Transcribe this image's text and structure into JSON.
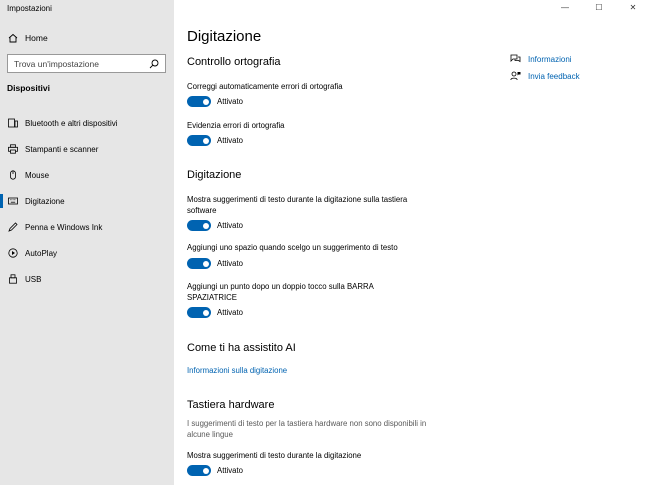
{
  "window": {
    "title": "Impostazioni",
    "minimize": "—",
    "maximize": "☐",
    "close": "✕"
  },
  "sidebar": {
    "home_label": "Home",
    "search_placeholder": "Trova un'impostazione",
    "section": "Dispositivi",
    "items": [
      {
        "label": "Bluetooth e altri dispositivi",
        "icon": "bluetooth-devices-icon"
      },
      {
        "label": "Stampanti e scanner",
        "icon": "printer-icon"
      },
      {
        "label": "Mouse",
        "icon": "mouse-icon"
      },
      {
        "label": "Digitazione",
        "icon": "keyboard-icon",
        "active": true
      },
      {
        "label": "Penna e Windows Ink",
        "icon": "pen-icon"
      },
      {
        "label": "AutoPlay",
        "icon": "autoplay-icon"
      },
      {
        "label": "USB",
        "icon": "usb-icon"
      }
    ]
  },
  "main": {
    "title": "Digitazione",
    "spell": {
      "heading": "Controllo ortografia",
      "autocorrect_label": "Correggi automaticamente errori di ortografia",
      "autocorrect_state": "Attivato",
      "highlight_label": "Evidenzia errori di ortografia",
      "highlight_state": "Attivato"
    },
    "typing": {
      "heading": "Digitazione",
      "suggestions_label": "Mostra suggerimenti di testo durante la digitazione sulla tastiera software",
      "suggestions_state": "Attivato",
      "space_label": "Aggiungi uno spazio quando scelgo un suggerimento di testo",
      "space_state": "Attivato",
      "period_label": "Aggiungi un punto dopo un doppio tocco sulla BARRA SPAZIATRICE",
      "period_state": "Attivato"
    },
    "ai": {
      "heading": "Come ti ha assistito AI",
      "link": "Informazioni sulla digitazione"
    },
    "hardware": {
      "heading": "Tastiera hardware",
      "description": "I suggerimenti di testo per la tastiera hardware non sono disponibili in alcune lingue",
      "suggestions_label": "Mostra suggerimenti di testo durante la digitazione",
      "suggestions_state": "Attivato"
    }
  },
  "help": {
    "info": "Informazioni",
    "feedback": "Invia feedback"
  },
  "colors": {
    "accent": "#0063b1",
    "sidebar_bg": "#e6e6e6"
  }
}
